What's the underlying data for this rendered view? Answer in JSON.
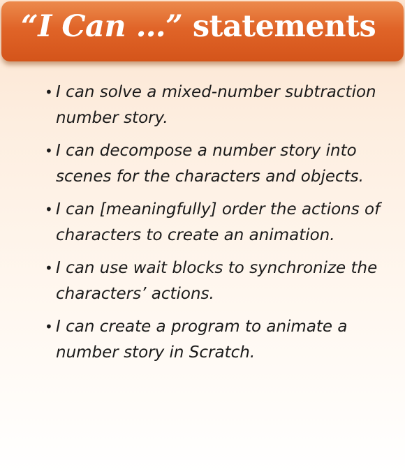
{
  "title": {
    "quote_part": "“I Can …”",
    "rest": " statements"
  },
  "bullet_symbol": "•",
  "statements": [
    "I can solve a mixed-number subtraction number story.",
    "I can decompose a number story into scenes for the characters and objects.",
    "I can [meaningfully] order the actions of characters to create an animation.",
    "I can use wait blocks to synchronize the characters’ actions.",
    "I can create a program to animate a number story in Scratch."
  ],
  "colors": {
    "banner": "#e06428",
    "title_text": "#ffffff",
    "body_text": "#1a1a1a",
    "background_top": "#fde4cf"
  }
}
